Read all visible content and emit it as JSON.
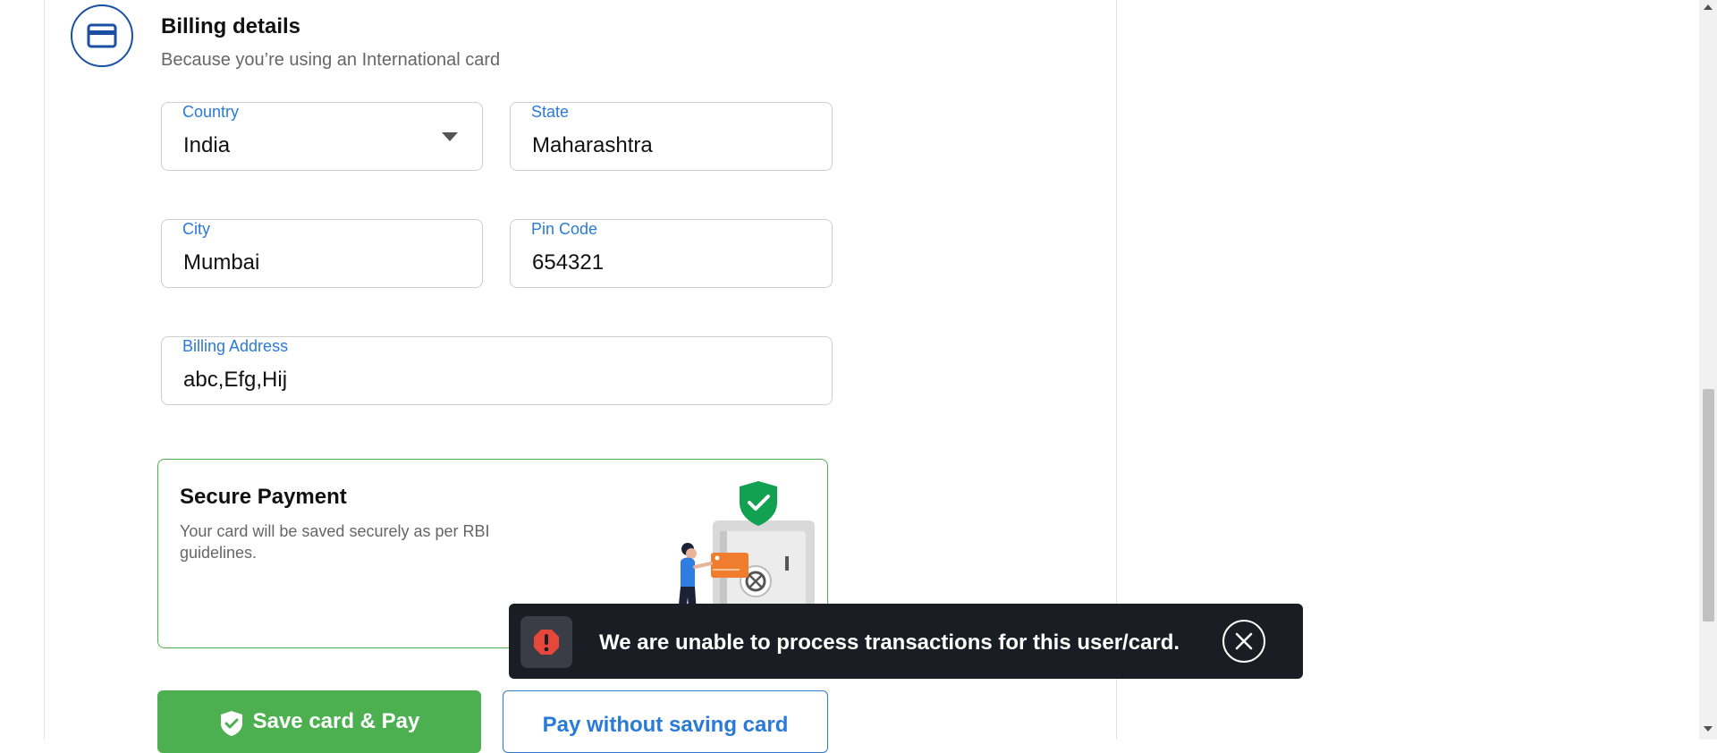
{
  "billing": {
    "title": "Billing details",
    "subtitle": "Because you’re using an International card",
    "icon": "credit-card-icon",
    "fields": {
      "country": {
        "label": "Country",
        "value": "India"
      },
      "state": {
        "label": "State",
        "value": "Maharashtra"
      },
      "city": {
        "label": "City",
        "value": "Mumbai"
      },
      "pin": {
        "label": "Pin Code",
        "value": "654321"
      },
      "address": {
        "label": "Billing Address",
        "value": "abc,Efg,Hij"
      }
    }
  },
  "secure": {
    "title": "Secure Payment",
    "text": "Your card will be saved securely as per RBI guidelines."
  },
  "toast": {
    "message": "We are unable to process transactions for this user/card.",
    "icon": "error-icon",
    "close_icon": "close-icon"
  },
  "buttons": {
    "save_pay": "Save card & Pay",
    "pay_without_saving": "Pay without saving card"
  },
  "colors": {
    "accent_blue": "#2a7ad8",
    "icon_navy": "#1b4fa3",
    "success_green": "#4cb050",
    "toast_bg": "#1a1d24",
    "error_red": "#e5483b"
  }
}
